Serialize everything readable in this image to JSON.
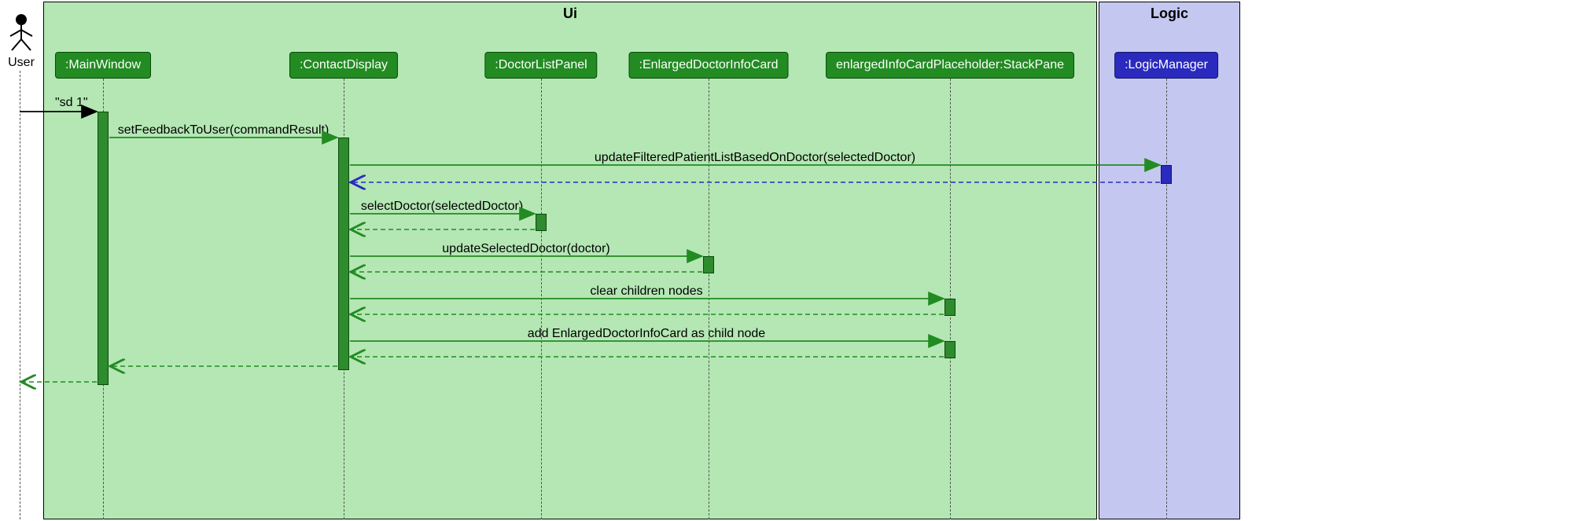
{
  "frames": {
    "ui": "Ui",
    "logic": "Logic"
  },
  "actor": "User",
  "lifelines": {
    "main_window": ":MainWindow",
    "contact_display": ":ContactDisplay",
    "doctor_list_panel": ":DoctorListPanel",
    "enlarged_card": ":EnlargedDoctorInfoCard",
    "placeholder": "enlargedInfoCardPlaceholder:StackPane",
    "logic_manager": ":LogicManager"
  },
  "messages": {
    "m0": "\"sd 1\"",
    "m1": "setFeedbackToUser(commandResult)",
    "m2": "updateFilteredPatientListBasedOnDoctor(selectedDoctor)",
    "m3": "selectDoctor(selectedDoctor)",
    "m4": "updateSelectedDoctor(doctor)",
    "m5": "clear children nodes",
    "m6": "add EnlargedDoctorInfoCard as child node"
  },
  "chart_data": {
    "type": "sequence_diagram",
    "actors": [
      "User"
    ],
    "frames": [
      {
        "name": "Ui",
        "participants": [
          ":MainWindow",
          ":ContactDisplay",
          ":DoctorListPanel",
          ":EnlargedDoctorInfoCard",
          "enlargedInfoCardPlaceholder:StackPane"
        ]
      },
      {
        "name": "Logic",
        "participants": [
          ":LogicManager"
        ]
      }
    ],
    "interactions": [
      {
        "from": "User",
        "to": ":MainWindow",
        "label": "\"sd 1\"",
        "type": "sync"
      },
      {
        "from": ":MainWindow",
        "to": ":ContactDisplay",
        "label": "setFeedbackToUser(commandResult)",
        "type": "sync"
      },
      {
        "from": ":ContactDisplay",
        "to": ":LogicManager",
        "label": "updateFilteredPatientListBasedOnDoctor(selectedDoctor)",
        "type": "sync"
      },
      {
        "from": ":LogicManager",
        "to": ":ContactDisplay",
        "type": "return"
      },
      {
        "from": ":ContactDisplay",
        "to": ":DoctorListPanel",
        "label": "selectDoctor(selectedDoctor)",
        "type": "sync"
      },
      {
        "from": ":DoctorListPanel",
        "to": ":ContactDisplay",
        "type": "return"
      },
      {
        "from": ":ContactDisplay",
        "to": ":EnlargedDoctorInfoCard",
        "label": "updateSelectedDoctor(doctor)",
        "type": "sync"
      },
      {
        "from": ":EnlargedDoctorInfoCard",
        "to": ":ContactDisplay",
        "type": "return"
      },
      {
        "from": ":ContactDisplay",
        "to": "enlargedInfoCardPlaceholder:StackPane",
        "label": "clear children nodes",
        "type": "sync"
      },
      {
        "from": "enlargedInfoCardPlaceholder:StackPane",
        "to": ":ContactDisplay",
        "type": "return"
      },
      {
        "from": ":ContactDisplay",
        "to": "enlargedInfoCardPlaceholder:StackPane",
        "label": "add EnlargedDoctorInfoCard as child node",
        "type": "sync"
      },
      {
        "from": "enlargedInfoCardPlaceholder:StackPane",
        "to": ":ContactDisplay",
        "type": "return"
      },
      {
        "from": ":ContactDisplay",
        "to": ":MainWindow",
        "type": "return"
      },
      {
        "from": ":MainWindow",
        "to": "User",
        "type": "return"
      }
    ]
  }
}
